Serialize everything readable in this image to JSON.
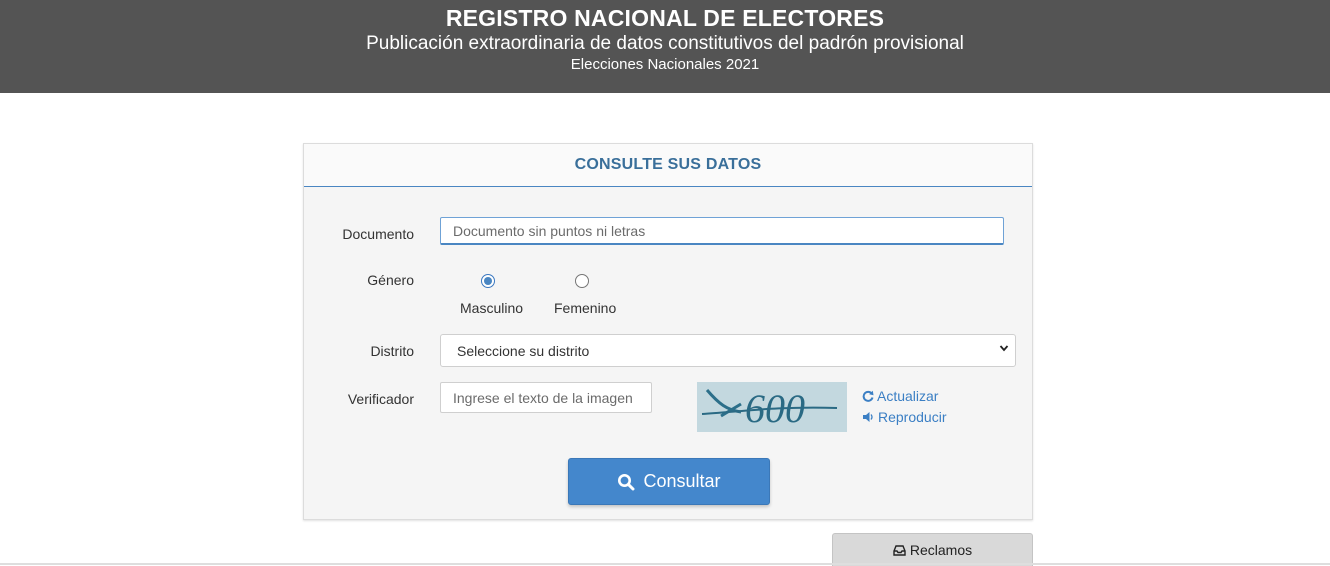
{
  "header": {
    "title": "REGISTRO NACIONAL DE ELECTORES",
    "subtitle": "Publicación extraordinaria de datos constitutivos del padrón provisional",
    "election": "Elecciones Nacionales 2021"
  },
  "panel": {
    "title": "CONSULTE SUS DATOS",
    "documento": {
      "label": "Documento",
      "value": "",
      "placeholder": "Documento sin puntos ni letras"
    },
    "genero": {
      "label": "Género",
      "options": [
        {
          "label": "Masculino",
          "selected": true
        },
        {
          "label": "Femenino",
          "selected": false
        }
      ]
    },
    "distrito": {
      "label": "Distrito",
      "selected": "Seleccione su distrito"
    },
    "verificador": {
      "label": "Verificador",
      "value": "",
      "placeholder": "Ingrese el texto de la imagen",
      "captcha_text": "Y600",
      "refresh_label": "Actualizar",
      "refresh_icon": "refresh-icon",
      "audio_label": "Reproducir",
      "audio_icon": "volume-icon"
    },
    "submit": {
      "label": "Consultar",
      "icon": "search-icon"
    }
  },
  "footer": {
    "reclamos_label": "Reclamos",
    "reclamos_icon": "inbox-icon"
  },
  "colors": {
    "header_bg": "#545454",
    "accent": "#4487cc",
    "panel_title": "#3a6f9a",
    "link": "#3b7fc4"
  }
}
